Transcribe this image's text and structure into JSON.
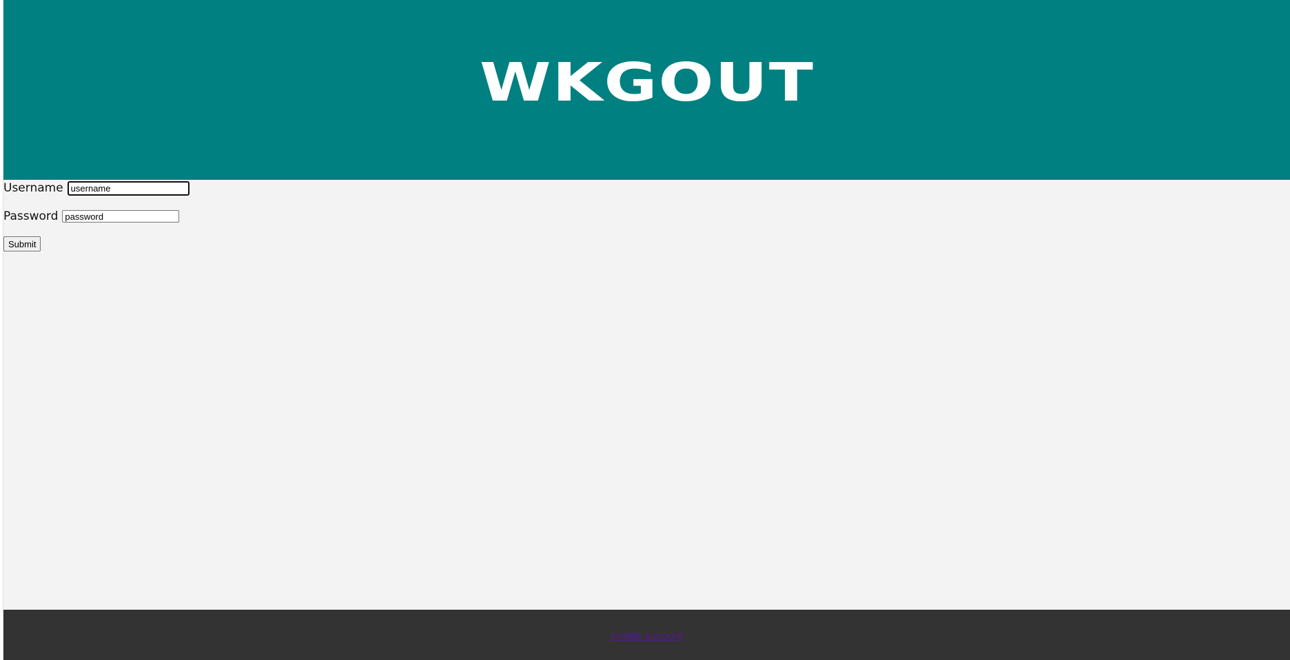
{
  "header": {
    "logo_text": "WKGOUT",
    "background_color": "#008080"
  },
  "login_form": {
    "username_label": "Username",
    "username_value": "username",
    "password_label": "Password",
    "password_value": "password",
    "submit_label": "Submit"
  },
  "footer": {
    "link_text": "create account",
    "background_color": "#333333",
    "link_color": "#551a8b"
  },
  "colors": {
    "page_background": "#f3f3f3"
  }
}
